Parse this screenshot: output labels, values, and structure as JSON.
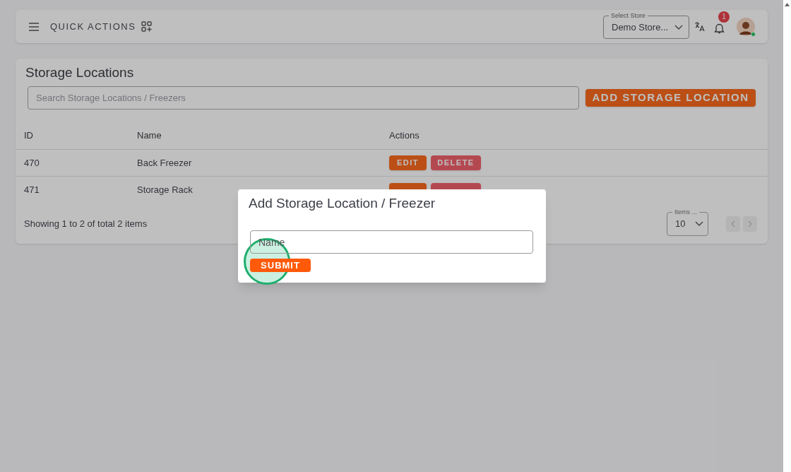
{
  "header": {
    "quick_actions": "QUICK ACTIONS",
    "store_select": {
      "label": "Select Store",
      "value": "Demo Store..."
    },
    "notification_count": "1",
    "online": true
  },
  "page": {
    "title": "Storage Locations",
    "search": {
      "placeholder": "Search Storage Locations / Freezers"
    },
    "add_button": "ADD STORAGE LOCATION",
    "table": {
      "columns": [
        "ID",
        "Name",
        "Actions"
      ],
      "rows": [
        {
          "id": "470",
          "name": "Back Freezer",
          "actions": [
            {
              "kind": "edit",
              "label": "EDIT"
            },
            {
              "kind": "delete",
              "label": "DELETE"
            }
          ]
        },
        {
          "id": "471",
          "name": "Storage Rack",
          "actions": [
            {
              "kind": "edit"
            },
            {
              "kind": "delete"
            }
          ]
        }
      ]
    },
    "summary": "Showing 1 to 2 of total 2 items",
    "page_size": {
      "label": "Items ...",
      "value": "10"
    },
    "pager": [
      {
        "kind": "prev",
        "disabled": true
      },
      {
        "kind": "next",
        "disabled": true
      }
    ]
  },
  "dialog": {
    "title": "Add Storage Location / Freezer",
    "name_field": {
      "placeholder": "Name"
    },
    "submit": "SUBMIT"
  }
}
